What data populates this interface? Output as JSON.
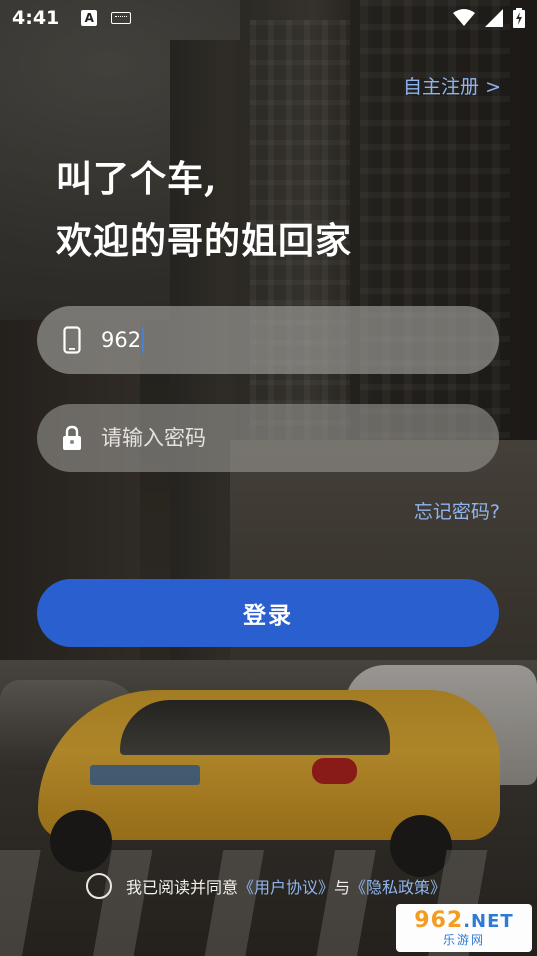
{
  "status_bar": {
    "time": "4:41",
    "icons": [
      "a-keyboard-icon",
      "keyboard-icon",
      "wifi-icon",
      "cell-signal-icon",
      "battery-charging-icon"
    ]
  },
  "register": {
    "label": "自主注册 >"
  },
  "headline": {
    "line1": "叫了个车,",
    "line2": "欢迎的哥的姐回家"
  },
  "phone_field": {
    "value": "962",
    "icon": "phone-icon"
  },
  "password_field": {
    "placeholder": "请输入密码",
    "icon": "lock-icon"
  },
  "forgot_password": {
    "label": "忘记密码?"
  },
  "login_button": {
    "label": "登录",
    "color": "#2a5fcf"
  },
  "agreement": {
    "prefix": "我已阅读并同意",
    "user_agreement": "《用户协议》",
    "conjunction": "与",
    "privacy_policy": "《隐私政策》",
    "checked": false
  },
  "watermark": {
    "top": "962",
    "net": ".NET",
    "bottom": "乐游网"
  },
  "colors": {
    "link": "#8fb4ee",
    "accent": "#2a5fcf"
  }
}
